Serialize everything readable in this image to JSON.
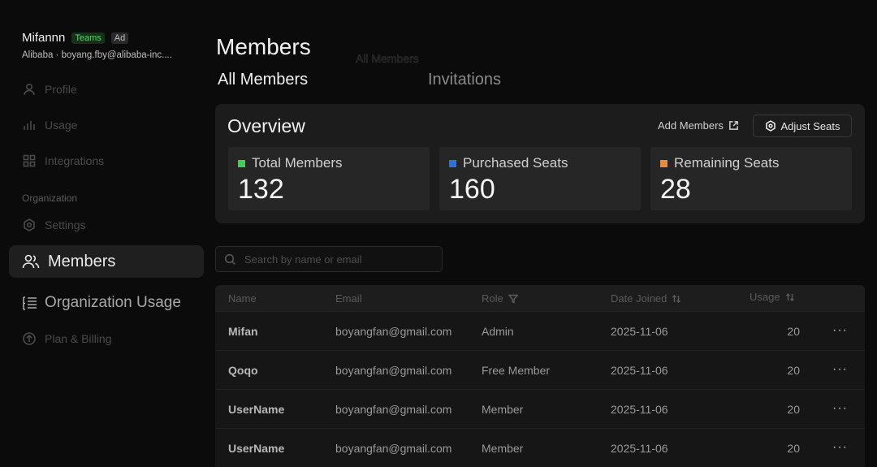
{
  "account": {
    "name": "Mifannn",
    "badge_teams": "Teams",
    "badge_ad": "Ad",
    "subtitle": "Alibaba · boyang.fby@alibaba-inc...."
  },
  "sidebar": {
    "items": [
      {
        "label": "Profile",
        "icon": "user-icon"
      },
      {
        "label": "Usage",
        "icon": "bar-chart-icon"
      },
      {
        "label": "Integrations",
        "icon": "grid-icon"
      }
    ],
    "section_label": "Organization",
    "org_items": [
      {
        "label": "Settings",
        "icon": "gear-icon"
      },
      {
        "label": "Members",
        "icon": "users-icon"
      },
      {
        "label": "Organization Usage",
        "icon": "list-icon"
      },
      {
        "label": "Plan & Billing",
        "icon": "arrow-up-circle-icon"
      }
    ]
  },
  "main": {
    "title": "Members",
    "ghost_text": "All Members",
    "tabs": [
      {
        "label": "All Members",
        "active": true
      },
      {
        "label": "Invitations",
        "active": false
      }
    ]
  },
  "overview": {
    "title": "Overview",
    "add_members_label": "Add Members",
    "adjust_seats_label": "Adjust Seats",
    "cards": [
      {
        "label": "Total Members",
        "value": "132",
        "color": "#3ecf5a"
      },
      {
        "label": "Purchased Seats",
        "value": "160",
        "color": "#2f6fe0"
      },
      {
        "label": "Remaining Seats",
        "value": "28",
        "color": "#f08a2e"
      }
    ]
  },
  "search": {
    "placeholder": "Search by name or email"
  },
  "table": {
    "columns": [
      "Name",
      "Email",
      "Role",
      "Date Joined",
      "Usage"
    ],
    "rows": [
      {
        "name": "Mifan",
        "email": "boyangfan@gmail.com",
        "role": "Admin",
        "date": "2025-11-06",
        "usage": "20"
      },
      {
        "name": "Qoqo",
        "email": "boyangfan@gmail.com",
        "role": "Free Member",
        "date": "2025-11-06",
        "usage": "20"
      },
      {
        "name": "UserName",
        "email": "boyangfan@gmail.com",
        "role": "Member",
        "date": "2025-11-06",
        "usage": "20"
      },
      {
        "name": "UserName",
        "email": "boyangfan@gmail.com",
        "role": "Member",
        "date": "2025-11-06",
        "usage": "20"
      }
    ],
    "more_label": "···"
  }
}
